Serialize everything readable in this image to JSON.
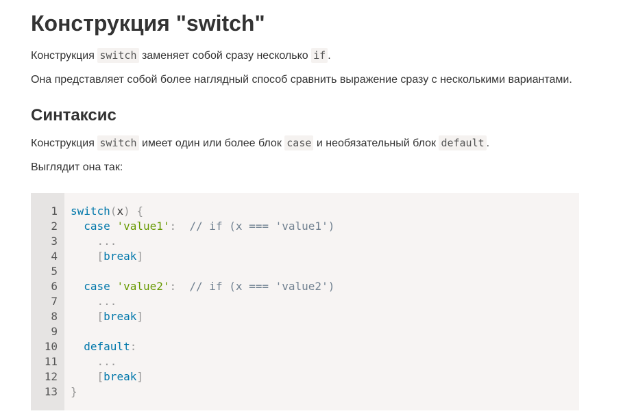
{
  "title": "Конструкция \"switch\"",
  "intro": {
    "p1_before": "Конструкция ",
    "p1_code1": "switch",
    "p1_middle": " заменяет собой сразу несколько ",
    "p1_code2": "if",
    "p1_after": ".",
    "p2": "Она представляет собой более наглядный способ сравнить выражение сразу с несколькими вариантами."
  },
  "syntax": {
    "heading": "Синтаксис",
    "p3_before": "Конструкция ",
    "p3_code1": "switch",
    "p3_mid1": " имеет один или более блок ",
    "p3_code2": "case",
    "p3_mid2": " и необязательный блок ",
    "p3_code3": "default",
    "p3_after": ".",
    "p4": "Выглядит она так:"
  },
  "code": {
    "line_numbers": [
      "1",
      "2",
      "3",
      "4",
      "5",
      "6",
      "7",
      "8",
      "9",
      "10",
      "11",
      "12",
      "13"
    ],
    "lines": [
      [
        {
          "t": "switch",
          "c": "kw"
        },
        {
          "t": "(",
          "c": "pn"
        },
        {
          "t": "x",
          "c": ""
        },
        {
          "t": ") {",
          "c": "pn"
        }
      ],
      [
        {
          "t": "  ",
          "c": ""
        },
        {
          "t": "case",
          "c": "kw"
        },
        {
          "t": " ",
          "c": ""
        },
        {
          "t": "'value1'",
          "c": "str"
        },
        {
          "t": ":",
          "c": "pn"
        },
        {
          "t": "  // if (x === 'value1')",
          "c": "cm"
        }
      ],
      [
        {
          "t": "    ",
          "c": ""
        },
        {
          "t": "...",
          "c": "pn"
        }
      ],
      [
        {
          "t": "    ",
          "c": ""
        },
        {
          "t": "[",
          "c": "pn"
        },
        {
          "t": "break",
          "c": "kw"
        },
        {
          "t": "]",
          "c": "pn"
        }
      ],
      [
        {
          "t": "",
          "c": ""
        }
      ],
      [
        {
          "t": "  ",
          "c": ""
        },
        {
          "t": "case",
          "c": "kw"
        },
        {
          "t": " ",
          "c": ""
        },
        {
          "t": "'value2'",
          "c": "str"
        },
        {
          "t": ":",
          "c": "pn"
        },
        {
          "t": "  // if (x === 'value2')",
          "c": "cm"
        }
      ],
      [
        {
          "t": "    ",
          "c": ""
        },
        {
          "t": "...",
          "c": "pn"
        }
      ],
      [
        {
          "t": "    ",
          "c": ""
        },
        {
          "t": "[",
          "c": "pn"
        },
        {
          "t": "break",
          "c": "kw"
        },
        {
          "t": "]",
          "c": "pn"
        }
      ],
      [
        {
          "t": "",
          "c": ""
        }
      ],
      [
        {
          "t": "  ",
          "c": ""
        },
        {
          "t": "default",
          "c": "kw"
        },
        {
          "t": ":",
          "c": "pn"
        }
      ],
      [
        {
          "t": "    ",
          "c": ""
        },
        {
          "t": "...",
          "c": "pn"
        }
      ],
      [
        {
          "t": "    ",
          "c": ""
        },
        {
          "t": "[",
          "c": "pn"
        },
        {
          "t": "break",
          "c": "kw"
        },
        {
          "t": "]",
          "c": "pn"
        }
      ],
      [
        {
          "t": "}",
          "c": "pn"
        }
      ]
    ]
  }
}
